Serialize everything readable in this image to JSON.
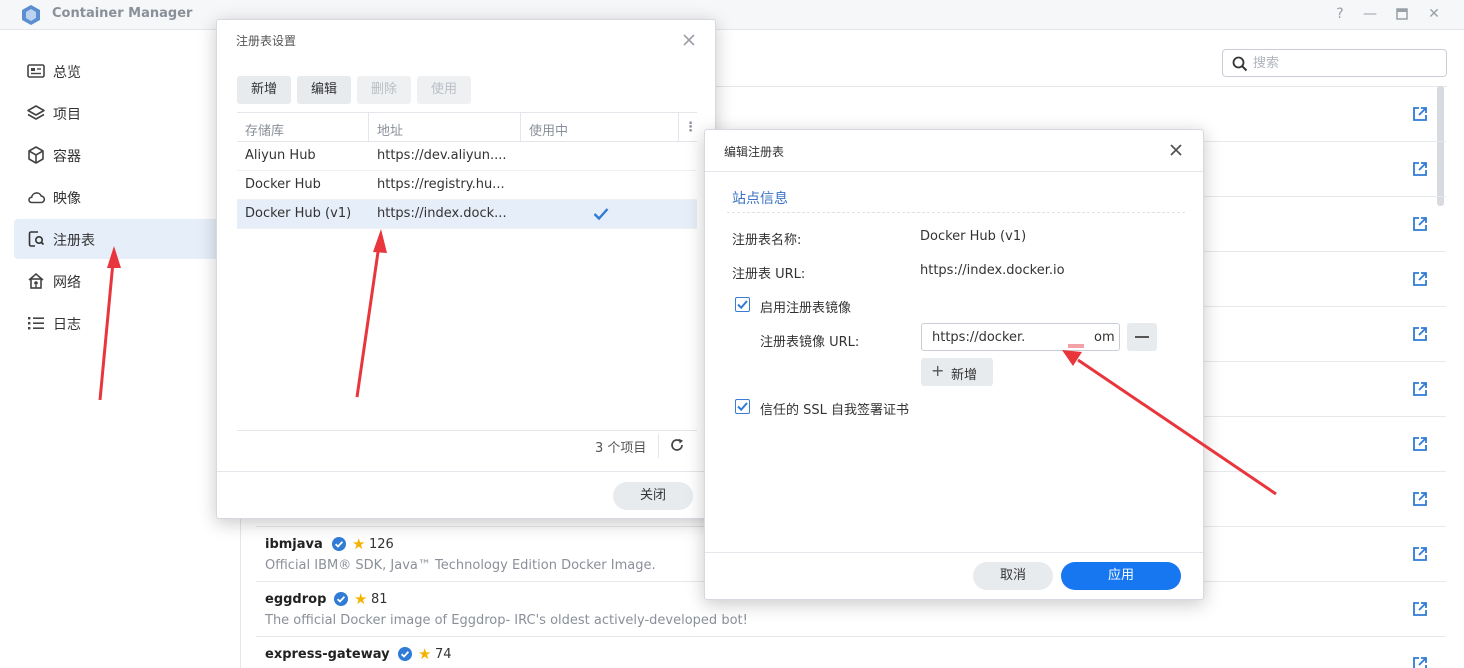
{
  "app": {
    "title": "Container Manager"
  },
  "window_controls": {
    "help": "?"
  },
  "sidebar": {
    "items": [
      {
        "label": "总览",
        "icon": "overview-icon"
      },
      {
        "label": "项目",
        "icon": "layers-icon"
      },
      {
        "label": "容器",
        "icon": "cube-icon"
      },
      {
        "label": "映像",
        "icon": "cloud-icon"
      },
      {
        "label": "注册表",
        "icon": "registry-search-icon",
        "active": true
      },
      {
        "label": "网络",
        "icon": "network-icon"
      },
      {
        "label": "日志",
        "icon": "list-icon"
      }
    ]
  },
  "search": {
    "placeholder": "搜索"
  },
  "images": [
    {
      "name": "ibmjava",
      "stars": "126",
      "description": "Official IBM® SDK, Java™ Technology Edition Docker Image."
    },
    {
      "name": "eggdrop",
      "stars": "81",
      "description": "The official Docker image of Eggdrop- IRC's oldest actively-developed bot!"
    },
    {
      "name": "express-gateway",
      "stars": "74",
      "description": ""
    }
  ],
  "registry_dialog": {
    "title": "注册表设置",
    "toolbar": {
      "add": "新增",
      "edit": "编辑",
      "delete": "删除",
      "use": "使用"
    },
    "columns": {
      "repo": "存储库",
      "address": "地址",
      "in_use": "使用中"
    },
    "rows": [
      {
        "repo": "Aliyun Hub",
        "address": "https://dev.aliyun....",
        "in_use": false
      },
      {
        "repo": "Docker Hub",
        "address": "https://registry.hu...",
        "in_use": false
      },
      {
        "repo": "Docker Hub (v1)",
        "address": "https://index.dock...",
        "in_use": true
      }
    ],
    "footer": {
      "count": "3 个项目",
      "close": "关闭"
    }
  },
  "edit_dialog": {
    "title": "编辑注册表",
    "section": "站点信息",
    "fields": {
      "name_label": "注册表名称:",
      "name_value": "Docker Hub (v1)",
      "url_label": "注册表 URL:",
      "url_value": "https://index.docker.io",
      "mirror_checkbox": "启用注册表镜像",
      "mirror_url_label": "注册表镜像 URL:",
      "mirror_url_value": "https://docker.",
      "mirror_url_suffix": "om",
      "add_button": "新增",
      "ssl_checkbox": "信任的 SSL 自我签署证书"
    },
    "buttons": {
      "cancel": "取消",
      "apply": "应用"
    }
  },
  "colors": {
    "accent": "#3a7bd5",
    "primary_button": "#1677f0",
    "arrow": "#e8363c"
  }
}
